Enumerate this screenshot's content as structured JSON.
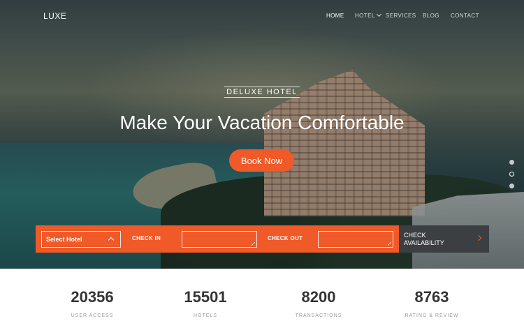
{
  "brand": {
    "logo": "LUXE"
  },
  "nav": {
    "items": [
      {
        "label": "HOME",
        "active": true
      },
      {
        "label": "HOTEL",
        "has_dropdown": true
      },
      {
        "label": "SERVICES"
      },
      {
        "label": "BLOG"
      },
      {
        "label": "CONTACT"
      }
    ]
  },
  "hero": {
    "kicker": "DELUXE HOTEL",
    "headline": "Make Your Vacation Comfortable",
    "cta": "Book Now",
    "slider_dots": 3,
    "active_dot": 2
  },
  "booking": {
    "select_hotel": "Select Hotel",
    "check_in_label": "CHECK IN",
    "check_in_value": "",
    "check_out_label": "CHECK OUT",
    "check_out_value": "",
    "check_button": "CHECK AVAILABILITY"
  },
  "stats": [
    {
      "value": "20356",
      "label": "USER ACCESS"
    },
    {
      "value": "15501",
      "label": "HOTELS"
    },
    {
      "value": "8200",
      "label": "TRANSACTIONS"
    },
    {
      "value": "8763",
      "label": "RATING & REVIEW"
    }
  ],
  "colors": {
    "accent": "#f05a28",
    "dark_panel": "#3b3f42",
    "stat_text": "#333333"
  }
}
